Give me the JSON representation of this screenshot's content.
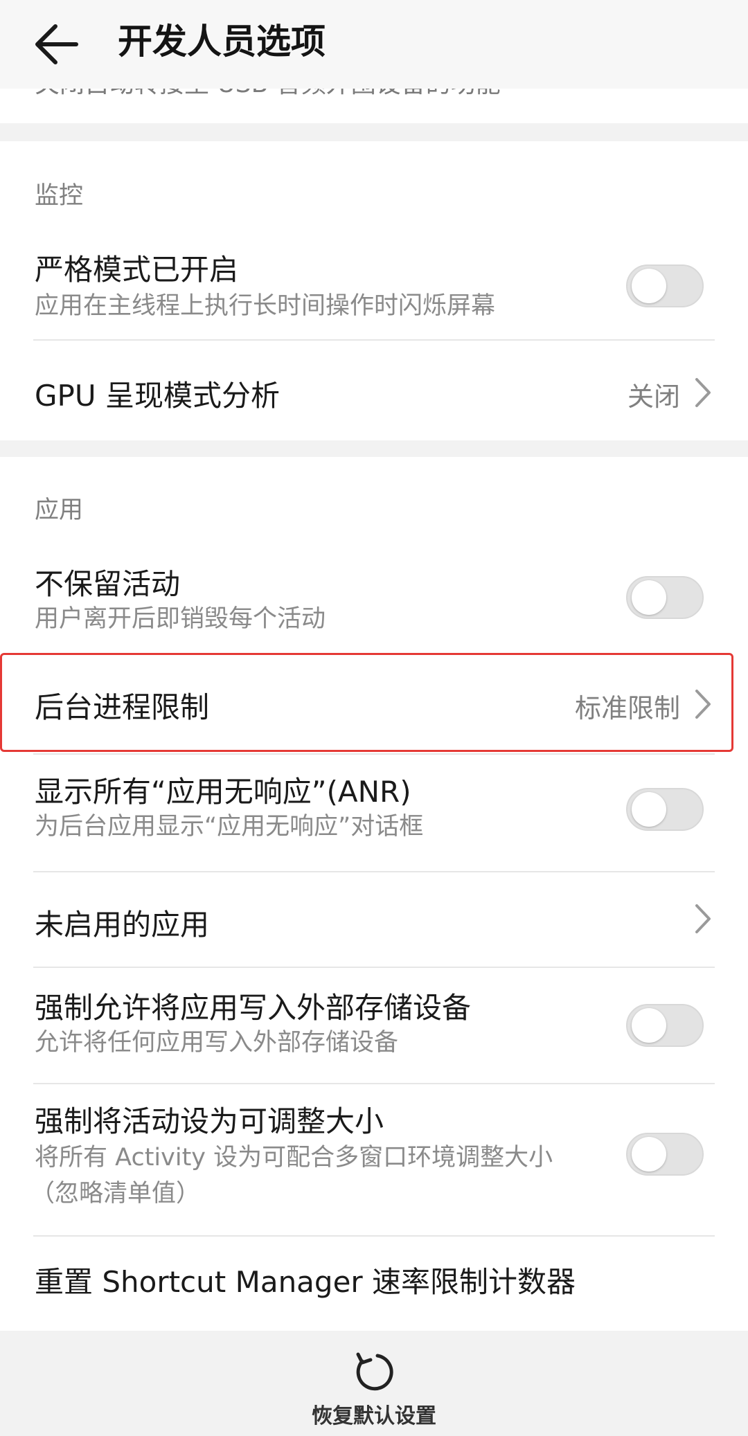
{
  "header": {
    "title": "开发人员选项"
  },
  "top_card": {
    "truncated_text": "关闭自动转接至 USB 音频外围设备的功能"
  },
  "monitoring": {
    "heading": "监控",
    "strict_mode": {
      "title": "严格模式已开启",
      "subtitle": "应用在主线程上执行长时间操作时闪烁屏幕",
      "enabled": false
    },
    "gpu_profile": {
      "title": "GPU 呈现模式分析",
      "value": "关闭"
    }
  },
  "apps": {
    "heading": "应用",
    "dont_keep": {
      "title": "不保留活动",
      "subtitle": "用户离开后即销毁每个活动",
      "enabled": false
    },
    "bg_limit": {
      "title": "后台进程限制",
      "value": "标准限制"
    },
    "anr": {
      "title": "显示所有“应用无响应”(ANR)",
      "subtitle": "为后台应用显示“应用无响应”对话框",
      "enabled": false
    },
    "inactive_apps": {
      "title": "未启用的应用"
    },
    "force_external": {
      "title": "强制允许将应用写入外部存储设备",
      "subtitle": "允许将任何应用写入外部存储设备",
      "enabled": false
    },
    "force_resizable": {
      "title": "强制将活动设为可调整大小",
      "subtitle_line1": "将所有 Activity 设为可配合多窗口环境调整大小",
      "subtitle_line2": "（忽略清单值）",
      "enabled": false
    },
    "reset_shortcut": {
      "title": "重置 Shortcut Manager 速率限制计数器"
    }
  },
  "footer": {
    "reset_label": "恢复默认设置",
    "icon": "reset-icon"
  },
  "colors": {
    "highlight": "#e53935",
    "toggle_off": "#e3e3e3"
  }
}
